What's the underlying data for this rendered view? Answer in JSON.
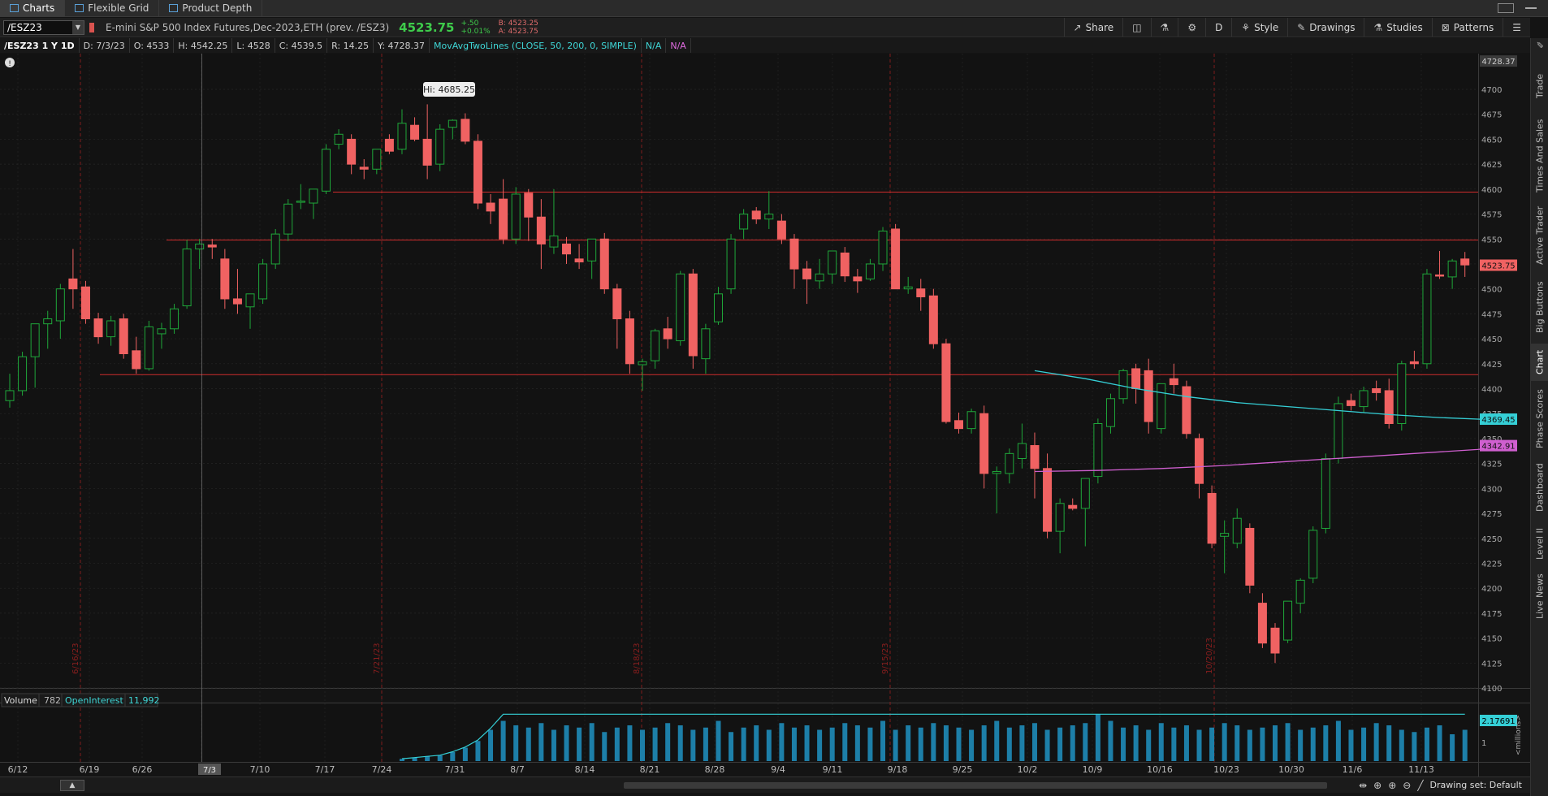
{
  "tabs": [
    {
      "label": "Charts",
      "active": true
    },
    {
      "label": "Flexible Grid",
      "active": false
    },
    {
      "label": "Product Depth",
      "active": false
    }
  ],
  "toolbar": {
    "symbol": "/ESZ23",
    "description": "E-mini S&P 500 Index Futures,Dec-2023,ETH (prev. /ESZ3)",
    "last": "4523.75",
    "change": "+.50",
    "change_pct": "+0.01%",
    "bid": "B: 4523.25",
    "ask": "A: 4523.75",
    "buttons": {
      "share": "Share",
      "aggregation": "D",
      "style": "Style",
      "drawings": "Drawings",
      "studies": "Studies",
      "patterns": "Patterns"
    }
  },
  "studybar": {
    "symbol_period": "/ESZ23 1 Y 1D",
    "date": "D: 7/3/23",
    "open": "O: 4533",
    "high": "H: 4542.25",
    "low": "L: 4528",
    "close": "C: 4539.5",
    "range": "R: 14.25",
    "y": "Y: 4728.37",
    "study": "MovAvgTwoLines (CLOSE, 50, 200, 0, SIMPLE)",
    "ma1_value": "N/A",
    "ma2_value": "N/A"
  },
  "right_tabs": [
    "Trade",
    "Times And Sales",
    "Active Trader",
    "Big Buttons",
    "Chart",
    "Phase Scores",
    "Dashboard",
    "Level II",
    "Live News"
  ],
  "right_tab_active": "Chart",
  "price_axis": {
    "ticks": [
      "4700",
      "4675",
      "4650",
      "4625",
      "4600",
      "4575",
      "4550",
      "4525",
      "4500",
      "4475",
      "4450",
      "4425",
      "4400",
      "4375",
      "4350",
      "4325",
      "4300",
      "4275",
      "4250",
      "4225",
      "4200",
      "4175",
      "4150",
      "4125",
      "4100"
    ],
    "cursor_label": "4728.37",
    "last_label": "4523.75",
    "ma50_label": "4369.45",
    "ma200_label": "4342.91"
  },
  "hi_label": "Hi: 4685.25",
  "date_axis": {
    "labels": [
      "6/12",
      "6/19",
      "6/26",
      "7/3",
      "7/10",
      "7/17",
      "7/24",
      "7/31",
      "8/7",
      "8/14",
      "8/21",
      "8/28",
      "9/4",
      "9/11",
      "9/18",
      "9/25",
      "10/2",
      "10/9",
      "10/16",
      "10/23",
      "10/30",
      "11/6",
      "11/13"
    ],
    "cursor_label": "7/3",
    "vertical_labels": [
      "6/16/23",
      "7/21/23",
      "8/18/23",
      "9/15/23",
      "10/20/23"
    ]
  },
  "volume": {
    "label": "Volume",
    "value": "782",
    "oi_label": "OpenInterest",
    "oi_value": "11,992",
    "axis_label": "2.17691",
    "tick": "1",
    "units": "<millions>"
  },
  "bottom": {
    "drawing_set": "Drawing set: Default"
  },
  "colors": {
    "up": "#1fa73a",
    "down": "#f06262",
    "ma50": "#35cfd6",
    "ma200": "#cf5fcf",
    "hline": "#d02c2c",
    "volume": "#1d7fa8"
  },
  "chart_data": {
    "type": "candlestick",
    "ylim": [
      4100,
      4740
    ],
    "candles": [
      {
        "o": 4388,
        "h": 4415,
        "l": 4381,
        "c": 4398
      },
      {
        "o": 4398,
        "h": 4437,
        "l": 4393,
        "c": 4432
      },
      {
        "o": 4432,
        "h": 4440,
        "l": 4401,
        "c": 4465
      },
      {
        "o": 4465,
        "h": 4478,
        "l": 4440,
        "c": 4470
      },
      {
        "o": 4468,
        "h": 4505,
        "l": 4450,
        "c": 4500
      },
      {
        "o": 4510,
        "h": 4540,
        "l": 4480,
        "c": 4500
      },
      {
        "o": 4502,
        "h": 4508,
        "l": 4465,
        "c": 4470
      },
      {
        "o": 4470,
        "h": 4476,
        "l": 4445,
        "c": 4452
      },
      {
        "o": 4452,
        "h": 4473,
        "l": 4443,
        "c": 4468
      },
      {
        "o": 4470,
        "h": 4475,
        "l": 4430,
        "c": 4435
      },
      {
        "o": 4438,
        "h": 4452,
        "l": 4415,
        "c": 4420
      },
      {
        "o": 4420,
        "h": 4468,
        "l": 4418,
        "c": 4462
      },
      {
        "o": 4455,
        "h": 4466,
        "l": 4440,
        "c": 4460
      },
      {
        "o": 4460,
        "h": 4485,
        "l": 4455,
        "c": 4480
      },
      {
        "o": 4483,
        "h": 4549,
        "l": 4480,
        "c": 4540
      },
      {
        "o": 4540,
        "h": 4550,
        "l": 4520,
        "c": 4545
      },
      {
        "o": 4544,
        "h": 4550,
        "l": 4530,
        "c": 4542
      },
      {
        "o": 4530,
        "h": 4540,
        "l": 4480,
        "c": 4490
      },
      {
        "o": 4490,
        "h": 4520,
        "l": 4475,
        "c": 4485
      },
      {
        "o": 4482,
        "h": 4493,
        "l": 4460,
        "c": 4495
      },
      {
        "o": 4490,
        "h": 4530,
        "l": 4485,
        "c": 4525
      },
      {
        "o": 4525,
        "h": 4560,
        "l": 4520,
        "c": 4555
      },
      {
        "o": 4555,
        "h": 4590,
        "l": 4548,
        "c": 4585
      },
      {
        "o": 4587,
        "h": 4605,
        "l": 4580,
        "c": 4588
      },
      {
        "o": 4586,
        "h": 4600,
        "l": 4570,
        "c": 4600
      },
      {
        "o": 4598,
        "h": 4645,
        "l": 4595,
        "c": 4640
      },
      {
        "o": 4645,
        "h": 4660,
        "l": 4640,
        "c": 4655
      },
      {
        "o": 4650,
        "h": 4655,
        "l": 4615,
        "c": 4625
      },
      {
        "o": 4622,
        "h": 4630,
        "l": 4610,
        "c": 4620
      },
      {
        "o": 4620,
        "h": 4640,
        "l": 4615,
        "c": 4640
      },
      {
        "o": 4650,
        "h": 4655,
        "l": 4635,
        "c": 4638
      },
      {
        "o": 4640,
        "h": 4680,
        "l": 4635,
        "c": 4666
      },
      {
        "o": 4664,
        "h": 4672,
        "l": 4648,
        "c": 4650
      },
      {
        "o": 4650,
        "h": 4685,
        "l": 4610,
        "c": 4624
      },
      {
        "o": 4625,
        "h": 4665,
        "l": 4618,
        "c": 4660
      },
      {
        "o": 4662,
        "h": 4670,
        "l": 4650,
        "c": 4669
      },
      {
        "o": 4670,
        "h": 4676,
        "l": 4645,
        "c": 4648
      },
      {
        "o": 4648,
        "h": 4655,
        "l": 4580,
        "c": 4586
      },
      {
        "o": 4586,
        "h": 4595,
        "l": 4565,
        "c": 4578
      },
      {
        "o": 4590,
        "h": 4610,
        "l": 4545,
        "c": 4550
      },
      {
        "o": 4550,
        "h": 4602,
        "l": 4545,
        "c": 4595
      },
      {
        "o": 4596,
        "h": 4600,
        "l": 4548,
        "c": 4572
      },
      {
        "o": 4572,
        "h": 4590,
        "l": 4520,
        "c": 4545
      },
      {
        "o": 4542,
        "h": 4600,
        "l": 4535,
        "c": 4553
      },
      {
        "o": 4545,
        "h": 4552,
        "l": 4525,
        "c": 4535
      },
      {
        "o": 4530,
        "h": 4545,
        "l": 4520,
        "c": 4527
      },
      {
        "o": 4528,
        "h": 4548,
        "l": 4510,
        "c": 4550
      },
      {
        "o": 4550,
        "h": 4556,
        "l": 4495,
        "c": 4500
      },
      {
        "o": 4500,
        "h": 4505,
        "l": 4440,
        "c": 4470
      },
      {
        "o": 4470,
        "h": 4478,
        "l": 4415,
        "c": 4425
      },
      {
        "o": 4424,
        "h": 4430,
        "l": 4398,
        "c": 4427
      },
      {
        "o": 4428,
        "h": 4460,
        "l": 4420,
        "c": 4458
      },
      {
        "o": 4460,
        "h": 4472,
        "l": 4440,
        "c": 4450
      },
      {
        "o": 4448,
        "h": 4518,
        "l": 4443,
        "c": 4515
      },
      {
        "o": 4515,
        "h": 4520,
        "l": 4420,
        "c": 4433
      },
      {
        "o": 4430,
        "h": 4465,
        "l": 4415,
        "c": 4460
      },
      {
        "o": 4467,
        "h": 4502,
        "l": 4464,
        "c": 4495
      },
      {
        "o": 4500,
        "h": 4555,
        "l": 4495,
        "c": 4550
      },
      {
        "o": 4560,
        "h": 4580,
        "l": 4550,
        "c": 4575
      },
      {
        "o": 4578,
        "h": 4582,
        "l": 4565,
        "c": 4570
      },
      {
        "o": 4570,
        "h": 4598,
        "l": 4560,
        "c": 4575
      },
      {
        "o": 4568,
        "h": 4575,
        "l": 4545,
        "c": 4550
      },
      {
        "o": 4550,
        "h": 4555,
        "l": 4500,
        "c": 4520
      },
      {
        "o": 4520,
        "h": 4528,
        "l": 4485,
        "c": 4510
      },
      {
        "o": 4508,
        "h": 4530,
        "l": 4500,
        "c": 4515
      },
      {
        "o": 4515,
        "h": 4535,
        "l": 4505,
        "c": 4538
      },
      {
        "o": 4536,
        "h": 4542,
        "l": 4507,
        "c": 4513
      },
      {
        "o": 4512,
        "h": 4520,
        "l": 4496,
        "c": 4508
      },
      {
        "o": 4510,
        "h": 4530,
        "l": 4508,
        "c": 4525
      },
      {
        "o": 4525,
        "h": 4562,
        "l": 4518,
        "c": 4558
      },
      {
        "o": 4560,
        "h": 4565,
        "l": 4500,
        "c": 4500
      },
      {
        "o": 4500,
        "h": 4512,
        "l": 4495,
        "c": 4502
      },
      {
        "o": 4500,
        "h": 4510,
        "l": 4478,
        "c": 4492
      },
      {
        "o": 4493,
        "h": 4500,
        "l": 4440,
        "c": 4445
      },
      {
        "o": 4445,
        "h": 4450,
        "l": 4365,
        "c": 4367
      },
      {
        "o": 4368,
        "h": 4376,
        "l": 4355,
        "c": 4360
      },
      {
        "o": 4360,
        "h": 4380,
        "l": 4355,
        "c": 4377
      },
      {
        "o": 4375,
        "h": 4383,
        "l": 4300,
        "c": 4315
      },
      {
        "o": 4315,
        "h": 4322,
        "l": 4275,
        "c": 4317
      },
      {
        "o": 4315,
        "h": 4340,
        "l": 4305,
        "c": 4335
      },
      {
        "o": 4330,
        "h": 4365,
        "l": 4320,
        "c": 4345
      },
      {
        "o": 4343,
        "h": 4356,
        "l": 4290,
        "c": 4320
      },
      {
        "o": 4320,
        "h": 4335,
        "l": 4250,
        "c": 4257
      },
      {
        "o": 4257,
        "h": 4290,
        "l": 4235,
        "c": 4285
      },
      {
        "o": 4283,
        "h": 4290,
        "l": 4278,
        "c": 4280
      },
      {
        "o": 4280,
        "h": 4305,
        "l": 4242,
        "c": 4310
      },
      {
        "o": 4312,
        "h": 4370,
        "l": 4305,
        "c": 4365
      },
      {
        "o": 4362,
        "h": 4395,
        "l": 4355,
        "c": 4390
      },
      {
        "o": 4390,
        "h": 4420,
        "l": 4385,
        "c": 4418
      },
      {
        "o": 4420,
        "h": 4425,
        "l": 4385,
        "c": 4400
      },
      {
        "o": 4418,
        "h": 4430,
        "l": 4355,
        "c": 4367
      },
      {
        "o": 4360,
        "h": 4400,
        "l": 4355,
        "c": 4405
      },
      {
        "o": 4410,
        "h": 4425,
        "l": 4395,
        "c": 4404
      },
      {
        "o": 4402,
        "h": 4408,
        "l": 4350,
        "c": 4355
      },
      {
        "o": 4350,
        "h": 4355,
        "l": 4290,
        "c": 4305
      },
      {
        "o": 4295,
        "h": 4303,
        "l": 4240,
        "c": 4245
      },
      {
        "o": 4252,
        "h": 4268,
        "l": 4215,
        "c": 4255
      },
      {
        "o": 4245,
        "h": 4280,
        "l": 4240,
        "c": 4270
      },
      {
        "o": 4260,
        "h": 4265,
        "l": 4195,
        "c": 4203
      },
      {
        "o": 4185,
        "h": 4195,
        "l": 4140,
        "c": 4145
      },
      {
        "o": 4160,
        "h": 4165,
        "l": 4125,
        "c": 4135
      },
      {
        "o": 4148,
        "h": 4185,
        "l": 4145,
        "c": 4187
      },
      {
        "o": 4185,
        "h": 4210,
        "l": 4175,
        "c": 4208
      },
      {
        "o": 4210,
        "h": 4262,
        "l": 4205,
        "c": 4258
      },
      {
        "o": 4260,
        "h": 4335,
        "l": 4255,
        "c": 4330
      },
      {
        "o": 4330,
        "h": 4392,
        "l": 4325,
        "c": 4385
      },
      {
        "o": 4388,
        "h": 4395,
        "l": 4378,
        "c": 4383
      },
      {
        "o": 4382,
        "h": 4402,
        "l": 4376,
        "c": 4398
      },
      {
        "o": 4400,
        "h": 4408,
        "l": 4388,
        "c": 4396
      },
      {
        "o": 4398,
        "h": 4410,
        "l": 4360,
        "c": 4365
      },
      {
        "o": 4365,
        "h": 4428,
        "l": 4358,
        "c": 4425
      },
      {
        "o": 4427,
        "h": 4438,
        "l": 4420,
        "c": 4425
      },
      {
        "o": 4425,
        "h": 4520,
        "l": 4420,
        "c": 4515
      },
      {
        "o": 4514,
        "h": 4538,
        "l": 4510,
        "c": 4513
      },
      {
        "o": 4512,
        "h": 4530,
        "l": 4500,
        "c": 4528
      },
      {
        "o": 4530,
        "h": 4537,
        "l": 4512,
        "c": 4524
      }
    ],
    "ma50_points": [
      [
        4418,
        0
      ],
      [
        4410,
        4
      ],
      [
        4400,
        8
      ],
      [
        4392,
        12
      ],
      [
        4386,
        16
      ],
      [
        4382,
        20
      ],
      [
        4378,
        24
      ],
      [
        4374,
        28
      ],
      [
        4371,
        32
      ],
      [
        4369,
        36
      ]
    ],
    "ma200_points": [
      [
        4317,
        0
      ],
      [
        4318,
        5
      ],
      [
        4320,
        10
      ],
      [
        4323,
        15
      ],
      [
        4327,
        20
      ],
      [
        4331,
        25
      ],
      [
        4335,
        30
      ],
      [
        4339,
        35
      ],
      [
        4343,
        38
      ]
    ],
    "hlines": [
      4597,
      4549,
      4414
    ],
    "volume_values": [
      0.1,
      0.15,
      0.2,
      0.25,
      0.4,
      0.6,
      0.9,
      1.4,
      1.8,
      1.6,
      1.5,
      1.7,
      1.4,
      1.6,
      1.5,
      1.7,
      1.3,
      1.5,
      1.6,
      1.4,
      1.5,
      1.7,
      1.6,
      1.4,
      1.5,
      1.8,
      1.3,
      1.5,
      1.6,
      1.4,
      1.7,
      1.5,
      1.6,
      1.4,
      1.5,
      1.7,
      1.6,
      1.5,
      1.8,
      1.4,
      1.6,
      1.5,
      1.7,
      1.6,
      1.5,
      1.4,
      1.6,
      1.8,
      1.5,
      1.6,
      1.7,
      1.4,
      1.5,
      1.6,
      1.7,
      2.1,
      1.8,
      1.5,
      1.6,
      1.4,
      1.7,
      1.5,
      1.6,
      1.4,
      1.5,
      1.7,
      1.6,
      1.4,
      1.5,
      1.6,
      1.7,
      1.4,
      1.5,
      1.6,
      1.8,
      1.4,
      1.5,
      1.7,
      1.6,
      1.4,
      1.3,
      1.5,
      1.6,
      1.2,
      1.4
    ],
    "volume_ma": 2.17691
  }
}
